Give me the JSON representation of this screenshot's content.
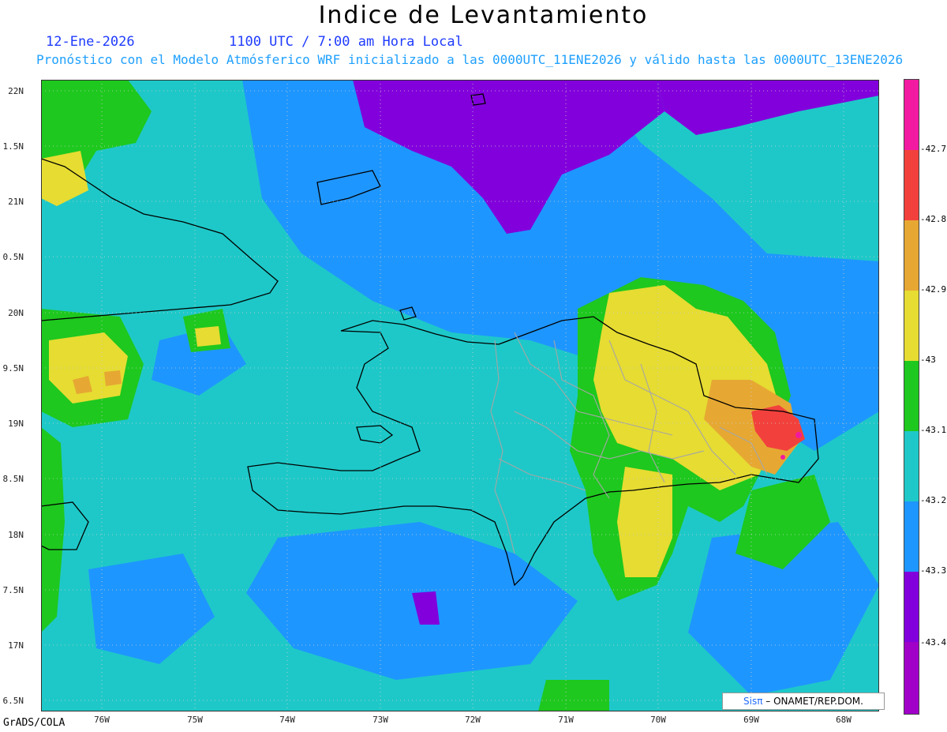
{
  "title": "Indice de Levantamiento",
  "date": "12-Ene-2026",
  "valid_time": "1100 UTC / 7:00 am Hora Local",
  "subtitle": "Pronóstico con el Modelo Atmósferico WRF inicializado a las 0000UTC_11ENE2026 y válido hasta las  0000UTC_13ENE2026",
  "credit": "GrADS/COLA",
  "brand": {
    "logo": "Sisπ",
    "text": "– ONAMET/REP.DOM."
  },
  "lat_labels": [
    "22N",
    "1.5N",
    "21N",
    "0.5N",
    "20N",
    "9.5N",
    "19N",
    "8.5N",
    "18N",
    "7.5N",
    "17N",
    "6.5N"
  ],
  "lon_labels": [
    "76W",
    "75W",
    "74W",
    "73W",
    "72W",
    "71W",
    "70W",
    "69W",
    "68W"
  ],
  "colorbar": {
    "colors": [
      "#f21aa0",
      "#f2413c",
      "#e6a833",
      "#e6dc32",
      "#1ec81e",
      "#1ec8c8",
      "#1e96ff",
      "#8200dc",
      "#a000c8"
    ],
    "labels": [
      "-42.7",
      "-42.8",
      "-42.9",
      "-43",
      "-43.1",
      "-43.2",
      "-43.3",
      "-43.4"
    ]
  },
  "palette": {
    "ocean": "#1ec8c8",
    "blue": "#1e96ff",
    "green": "#1ec81e",
    "yellow": "#e6dc32",
    "orange": "#e6a833",
    "red": "#f2413c",
    "violet": "#8200dc",
    "magenta": "#f21aa0"
  }
}
